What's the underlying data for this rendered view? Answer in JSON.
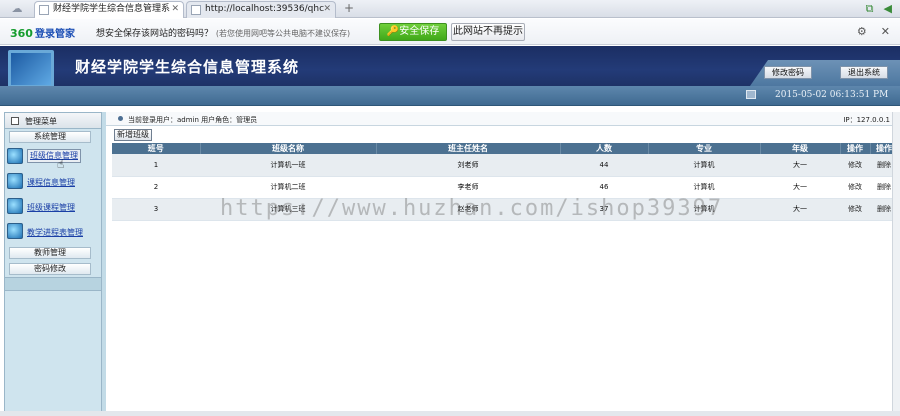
{
  "browser": {
    "tabs": [
      {
        "title": "财经学院学生综合信息管理系",
        "close": "✕"
      },
      {
        "title": "http://localhost:39536/qhc",
        "close": "✕"
      }
    ],
    "new_tab": "+"
  },
  "password_bar": {
    "brand": "360",
    "brand_sub": "登录管家",
    "message": "想安全保存该网站的密码吗？",
    "note": "(若您使用网吧等公共电脑不建议保存)",
    "save_label": "安全保存",
    "never_label": "此网站不再提示"
  },
  "header": {
    "title": "财经学院学生综合信息管理系统",
    "change_password": "修改密码",
    "logout": "退出系统",
    "datetime": "2015-05-02 06:13:51 PM"
  },
  "sidebar": {
    "title": "管理菜单",
    "categories": {
      "system": "系统管理",
      "teacher": "教师管理",
      "password": "密码修改"
    },
    "items": [
      {
        "label": "班级信息管理"
      },
      {
        "label": "课程信息管理"
      },
      {
        "label": "班级课程管理"
      },
      {
        "label": "教学进程表管理"
      }
    ]
  },
  "main": {
    "user_info": "当前登录用户：admin  用户角色：管理员",
    "ip": "IP：127.0.0.1",
    "add_label": "新增班级",
    "columns": [
      "班号",
      "班级名称",
      "班主任姓名",
      "人数",
      "专业",
      "年级",
      "操作",
      "操作"
    ],
    "rows": [
      {
        "id": "1",
        "name": "计算机一班",
        "teacher": "刘老师",
        "count": "44",
        "major": "计算机",
        "grade": "大一",
        "edit": "修改",
        "del": "删除"
      },
      {
        "id": "2",
        "name": "计算机二班",
        "teacher": "李老师",
        "count": "46",
        "major": "计算机",
        "grade": "大一",
        "edit": "修改",
        "del": "删除"
      },
      {
        "id": "3",
        "name": "计算机三班",
        "teacher": "赵老师",
        "count": "37",
        "major": "计算机",
        "grade": "大一",
        "edit": "修改",
        "del": "删除"
      }
    ]
  },
  "watermark": "https://www.huzhan.com/ishop39397"
}
